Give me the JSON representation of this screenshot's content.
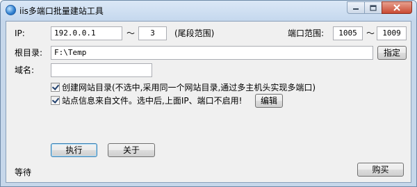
{
  "window": {
    "title": "iis多端口批量建站工具"
  },
  "ip": {
    "label": "IP:",
    "start": "192.0.0.1",
    "tilde": "～",
    "end": "3",
    "hint": "(尾段范围)"
  },
  "port": {
    "label": "端口范围:",
    "start": "1005",
    "tilde": "～",
    "end": "1009"
  },
  "root": {
    "label": "根目录:",
    "value": "F:\\Temp",
    "button": "指定"
  },
  "domain": {
    "label": "域名:",
    "value": ""
  },
  "options": {
    "create_dir": {
      "label": "创建网站目录(不选中,采用同一个网站目录,通过多主机头实现多端口)",
      "checked": true
    },
    "from_file": {
      "label": "站点信息来自文件。选中后,上面IP、端口不启用!",
      "checked": true,
      "edit_button": "编辑"
    }
  },
  "actions": {
    "run": "执行",
    "about": "关于",
    "buy": "购买"
  },
  "status": {
    "text": "等待"
  }
}
